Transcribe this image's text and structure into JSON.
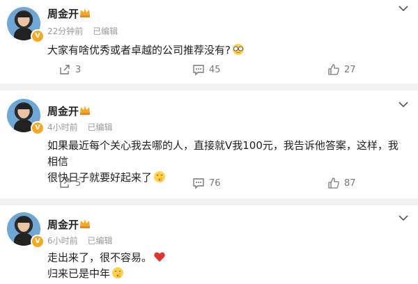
{
  "posts": [
    {
      "author": "周金开",
      "time": "22分钟前",
      "edited": "已编辑",
      "content_lines": [
        "大家有啥优秀或者卓越的公司推荐没有?"
      ],
      "actions": {
        "share": "3",
        "comment": "45",
        "like": "27"
      }
    },
    {
      "author": "周金开",
      "time": "4小时前",
      "edited": "已编辑",
      "content_lines": [
        "如果最近每个关心我去哪的人，直接就V我100元，我告诉他答案，这样，我相信",
        "很快日子就要好起来了"
      ],
      "actions": {
        "share": "5",
        "comment": "76",
        "like": "87"
      }
    },
    {
      "author": "周金开",
      "time": "6小时前",
      "edited": "已编辑",
      "content_lines": [
        "走出来了，很不容易。",
        "归来已是中年"
      ]
    }
  ],
  "icons": {
    "more": "chevron-down-icon",
    "share": "share-icon",
    "comment": "comment-icon",
    "like": "thumbs-up-icon",
    "verified": "verified-badge-icon",
    "crown": "crown-badge-icon"
  },
  "colors": {
    "separator": "#f2f2f2",
    "meta": "#9b9b9b",
    "verified": "#f6a822",
    "heart": "#e0342c"
  }
}
